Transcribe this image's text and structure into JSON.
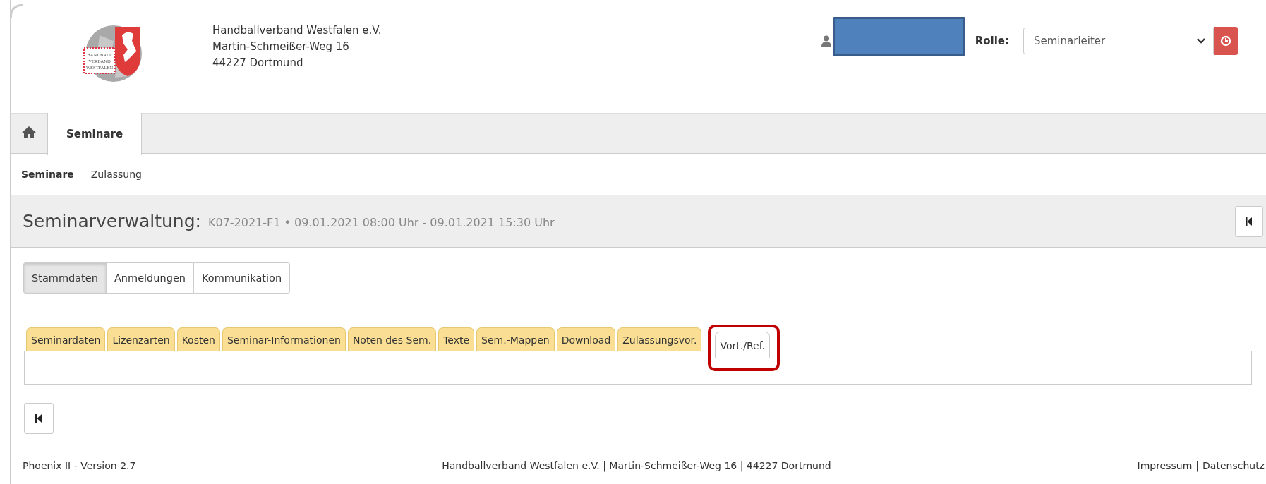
{
  "header": {
    "logo_lines": [
      "HANDBALL",
      "VERBAND",
      "WESTFALEN"
    ],
    "address_lines": [
      "Handballverband Westfalen e.V.",
      "Martin-Schmeißer-Weg 16",
      "44227 Dortmund"
    ],
    "user": {
      "redacted": true
    },
    "role_label": "Rolle:",
    "role_value": "Seminarleiter"
  },
  "main_nav": [
    {
      "kind": "home",
      "selected": false
    },
    {
      "kind": "text",
      "label": "Seminare",
      "selected": true
    }
  ],
  "sub_nav": [
    {
      "label": "Seminare",
      "selected": true
    },
    {
      "label": "Zulassung",
      "selected": false
    }
  ],
  "title_bar": {
    "heading": "Seminarverwaltung:",
    "detail": "K07-2021-F1 • 09.01.2021 08:00 Uhr - 09.01.2021 15:30 Uhr"
  },
  "view_buttons": [
    {
      "label": "Stammdaten",
      "selected": true
    },
    {
      "label": "Anmeldungen",
      "selected": false
    },
    {
      "label": "Kommunikation",
      "selected": false
    }
  ],
  "tabs": [
    {
      "label": "Seminardaten",
      "selected": false,
      "highlighted": false
    },
    {
      "label": "Lizenzarten",
      "selected": false,
      "highlighted": false
    },
    {
      "label": "Kosten",
      "selected": false,
      "highlighted": false
    },
    {
      "label": "Seminar-Informationen",
      "selected": false,
      "highlighted": false
    },
    {
      "label": "Noten des Sem.",
      "selected": false,
      "highlighted": false
    },
    {
      "label": "Texte",
      "selected": false,
      "highlighted": false
    },
    {
      "label": "Sem.-Mappen",
      "selected": false,
      "highlighted": false
    },
    {
      "label": "Download",
      "selected": false,
      "highlighted": false
    },
    {
      "label": "Zulassungsvor.",
      "selected": false,
      "highlighted": false
    },
    {
      "label": "Vort./Ref.",
      "selected": true,
      "highlighted": true
    }
  ],
  "footer": {
    "version": "Phoenix II - Version 2.7",
    "address": "Handballverband Westfalen e.V. | Martin-Schmeißer-Weg 16 | 44227 Dortmund",
    "links": [
      "Impressum",
      "Datenschutz"
    ],
    "separator": "|"
  }
}
